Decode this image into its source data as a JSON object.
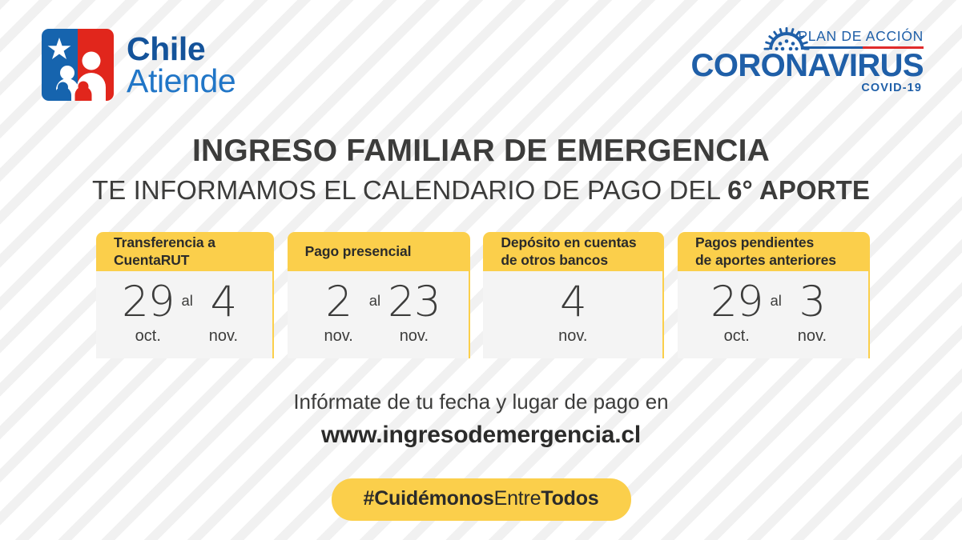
{
  "brand": {
    "chileatiende": {
      "line1": "Chile",
      "line2": "Atiende",
      "logo_icon": "chile-flag-family-icon",
      "blue": "#14539A",
      "light_blue": "#2176C7",
      "red": "#E1261C"
    },
    "coronavirus": {
      "plan_label": "PLAN DE ACCIÓN",
      "name": "CORONAVIRUS",
      "covid": "COVID-19",
      "virus_icon": "coronavirus-icon",
      "blue": "#1F5FA8",
      "red": "#E02B2B"
    }
  },
  "titles": {
    "main": "INGRESO FAMILIAR DE EMERGENCIA",
    "sub_prefix": "TE INFORMAMOS EL CALENDARIO DE PAGO DEL ",
    "sub_bold": "6° APORTE"
  },
  "cards": [
    {
      "title_line1": "Transferencia a",
      "title_line2": "CuentaRUT",
      "separator": "al",
      "dates": [
        {
          "day": "29",
          "month": "oct."
        },
        {
          "day": "4",
          "month": "nov."
        }
      ]
    },
    {
      "title_line1": "Pago presencial",
      "title_line2": "",
      "separator": "al",
      "dates": [
        {
          "day": "2",
          "month": "nov."
        },
        {
          "day": "23",
          "month": "nov."
        }
      ]
    },
    {
      "title_line1": "Depósito en cuentas",
      "title_line2": "de otros bancos",
      "separator": "",
      "dates": [
        {
          "day": "4",
          "month": "nov."
        }
      ]
    },
    {
      "title_line1": "Pagos pendientes",
      "title_line2": "de aportes anteriores",
      "separator": "al",
      "dates": [
        {
          "day": "29",
          "month": "oct."
        },
        {
          "day": "3",
          "month": "nov."
        }
      ]
    }
  ],
  "info": {
    "line1": "Infórmate de tu fecha y lugar de pago en",
    "url": "www.ingresodemergencia.cl",
    "cursor_icon": "click-cursor-icon"
  },
  "hashtag": {
    "part1": "#Cuidémonos",
    "part2": "Entre",
    "part3": "Todos"
  },
  "colors": {
    "yellow": "#FBCF4B",
    "card_body": "#F4F4F4",
    "text_dark": "#3C3C3B",
    "background": "#FFFFFF",
    "stripe": "#F1F1F1"
  }
}
